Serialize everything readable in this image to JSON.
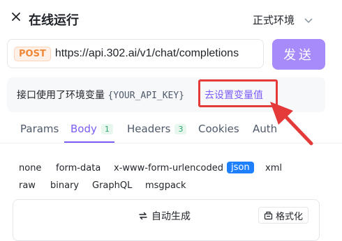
{
  "header": {
    "close_icon": "close-icon",
    "title": "在线运行",
    "environment": "正式环境"
  },
  "request": {
    "method": "POST",
    "url": "https://api.302.ai/v1/chat/completions",
    "send_label": "发送"
  },
  "notice": {
    "prefix": "接口使用了环境变量",
    "variable": "{YOUR_API_KEY}",
    "link": "去设置变量值"
  },
  "tabs": [
    {
      "label": "Params",
      "count": ""
    },
    {
      "label": "Body",
      "count": "1"
    },
    {
      "label": "Headers",
      "count": "3"
    },
    {
      "label": "Cookies",
      "count": ""
    },
    {
      "label": "Auth",
      "count": ""
    }
  ],
  "active_tab": "Body",
  "body_types": [
    "none",
    "form-data",
    "x-www-form-urlencoded",
    "json",
    "xml",
    "raw",
    "binary",
    "GraphQL",
    "msgpack"
  ],
  "selected_body_type": "json",
  "editor": {
    "auto_generate": "自动生成",
    "format": "格式化"
  },
  "colors": {
    "accent": "#a78bfa",
    "link": "#7c5cf5",
    "annotation": "#e43a3a",
    "selected_type": "#1e80ff"
  }
}
